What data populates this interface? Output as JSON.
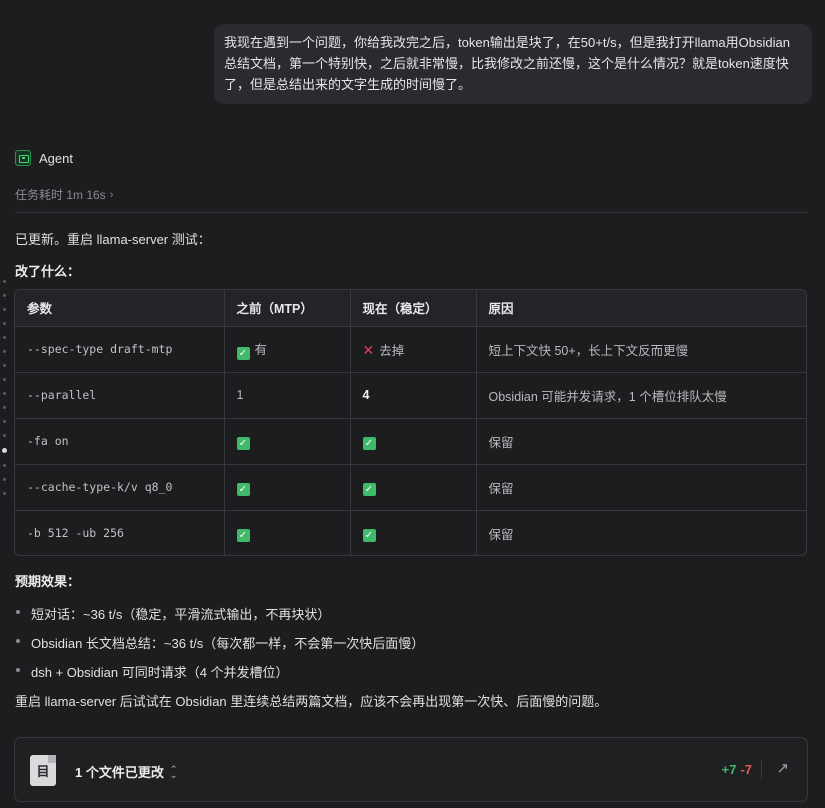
{
  "user_message": "我现在遇到一个问题，你给我改完之后，token输出是块了，在50+t/s，但是我打开llama用Obsidian总结文档，第一个特别快，之后就非常慢，比我修改之前还慢，这个是什么情况？就是token速度快了，但是总结出来的文字生成的时间慢了。",
  "agent": {
    "name": "Agent",
    "task_time": "任务耗时 1m 16s"
  },
  "intro": "已更新。重启 llama-server 测试：",
  "changes_heading": "改了什么：",
  "table": {
    "headers": [
      "参数",
      "之前（MTP）",
      "现在（稳定）",
      "原因"
    ],
    "rows": [
      {
        "param": "--spec-type draft-mtp",
        "before": "有",
        "now": "去掉",
        "reason": "短上下文快 50+，长上下文反而更慢"
      },
      {
        "param": "--parallel",
        "before": "1",
        "now": "4",
        "reason": "Obsidian 可能并发请求，1 个槽位排队太慢"
      },
      {
        "param": "-fa on",
        "before": "",
        "now": "",
        "reason": "保留"
      },
      {
        "param": "--cache-type-k/v q8_0",
        "before": "",
        "now": "",
        "reason": "保留"
      },
      {
        "param": "-b 512 -ub 256",
        "before": "",
        "now": "",
        "reason": "保留"
      }
    ]
  },
  "effects_heading": "预期效果：",
  "effects": [
    "短对话：~36 t/s（稳定，平滑流式输出，不再块状）",
    "Obsidian 长文档总结：~36 t/s（每次都一样，不会第一次快后面慢）",
    "dsh + Obsidian 可同时请求（4 个并发槽位）"
  ],
  "closing": "重启 llama-server 后试试在 Obsidian 里连续总结两篇文档，应该不会再出现第一次快、后面慢的问题。",
  "file_card": {
    "label": "1 个文件已更改",
    "additions": "+7",
    "deletions": "-7"
  },
  "colors": {
    "check": "#3fb96a",
    "cross": "#e0405a",
    "background": "#1c1d1f"
  }
}
